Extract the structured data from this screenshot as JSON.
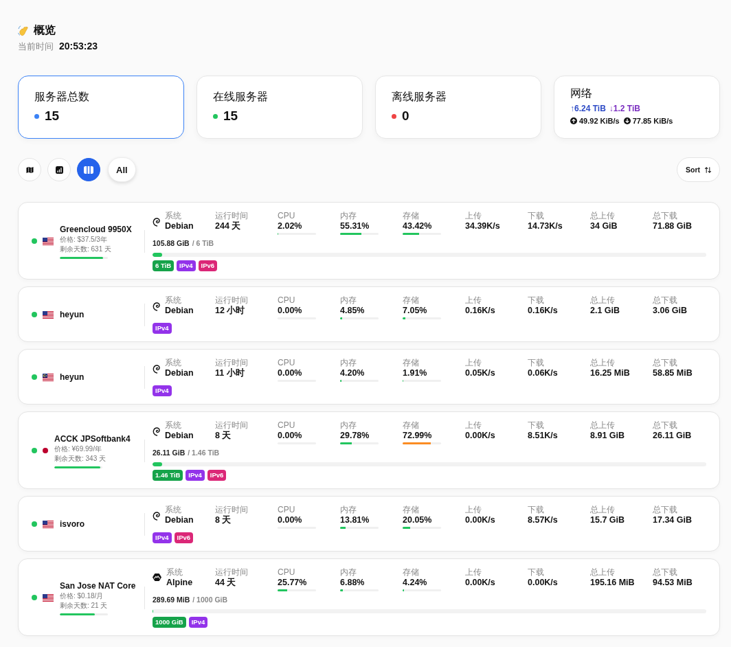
{
  "header": {
    "title": "概览",
    "time_label": "当前时间",
    "time": "20:53:23"
  },
  "stats": [
    {
      "kind": "count",
      "title": "服务器总数",
      "value": "15",
      "color": "#3b82f6",
      "selected": true
    },
    {
      "kind": "count",
      "title": "在线服务器",
      "value": "15",
      "color": "#22c55e",
      "selected": false
    },
    {
      "kind": "count",
      "title": "离线服务器",
      "value": "0",
      "color": "#ef4444",
      "selected": false
    },
    {
      "kind": "network",
      "title": "网络",
      "total_up": "↑6.24 TiB",
      "total_down": "↓1.2 TiB",
      "speed_up": "49.92 KiB/s",
      "speed_down": "77.85 KiB/s",
      "selected": false
    }
  ],
  "views": [
    {
      "kind": "map",
      "selected": false
    },
    {
      "kind": "chart",
      "selected": false
    },
    {
      "kind": "grid",
      "selected": true
    }
  ],
  "groups": [
    {
      "label": "All",
      "selected": true
    }
  ],
  "sort": {
    "label": "Sort"
  },
  "servers": [
    {
      "name": "Greencloud 9950X",
      "online": true,
      "flag": {
        "kind": "us"
      },
      "expiry": {
        "price": "价格: $37.5/3年",
        "remaining": "剩余天数: 631 天",
        "level": 0.9
      },
      "os": {
        "label": "系统",
        "name": "Debian",
        "kind": "debian"
      },
      "metrics": [
        {
          "kind": "text",
          "label": "运行时间",
          "value": "244 天"
        },
        {
          "kind": "meter",
          "label": "CPU",
          "value": "2.02%",
          "level": 0.0202
        },
        {
          "kind": "meter",
          "label": "内存",
          "value": "55.31%",
          "level": 0.5531
        },
        {
          "kind": "meter",
          "label": "存储",
          "value": "43.42%",
          "level": 0.4342
        },
        {
          "kind": "text",
          "label": "上传",
          "value": "34.39K/s"
        },
        {
          "kind": "text",
          "label": "下载",
          "value": "14.73K/s"
        },
        {
          "kind": "text",
          "label": "总上传",
          "value": "34 GiB"
        },
        {
          "kind": "text",
          "label": "总下载",
          "value": "71.88 GiB"
        }
      ],
      "traffic": {
        "used": "105.88 GiB",
        "total": "/ 6 TiB",
        "level": 0.017
      },
      "tags": [
        {
          "kind": "quota",
          "label": "6 TiB"
        },
        {
          "kind": "ipv4",
          "label": "IPv4"
        },
        {
          "kind": "ipv6",
          "label": "IPv6"
        }
      ]
    },
    {
      "name": "heyun",
      "online": true,
      "flag": {
        "kind": "us"
      },
      "os": {
        "label": "系统",
        "name": "Debian",
        "kind": "debian"
      },
      "metrics": [
        {
          "kind": "text",
          "label": "运行时间",
          "value": "12 小时"
        },
        {
          "kind": "meter",
          "label": "CPU",
          "value": "0.00%"
        },
        {
          "kind": "meter",
          "label": "内存",
          "value": "4.85%",
          "level": 0.0485
        },
        {
          "kind": "meter",
          "label": "存储",
          "value": "7.05%",
          "level": 0.0705
        },
        {
          "kind": "text",
          "label": "上传",
          "value": "0.16K/s"
        },
        {
          "kind": "text",
          "label": "下载",
          "value": "0.16K/s"
        },
        {
          "kind": "text",
          "label": "总上传",
          "value": "2.1 GiB"
        },
        {
          "kind": "text",
          "label": "总下载",
          "value": "3.06 GiB"
        }
      ],
      "tags": [
        {
          "kind": "ipv4",
          "label": "IPv4"
        }
      ]
    },
    {
      "name": "heyun",
      "online": true,
      "flag": {
        "kind": "my"
      },
      "os": {
        "label": "系统",
        "name": "Debian",
        "kind": "debian"
      },
      "metrics": [
        {
          "kind": "text",
          "label": "运行时间",
          "value": "11 小时"
        },
        {
          "kind": "meter",
          "label": "CPU",
          "value": "0.00%"
        },
        {
          "kind": "meter",
          "label": "内存",
          "value": "4.20%",
          "level": 0.042
        },
        {
          "kind": "meter",
          "label": "存储",
          "value": "1.91%",
          "level": 0.0191
        },
        {
          "kind": "text",
          "label": "上传",
          "value": "0.05K/s"
        },
        {
          "kind": "text",
          "label": "下载",
          "value": "0.06K/s"
        },
        {
          "kind": "text",
          "label": "总上传",
          "value": "16.25 MiB"
        },
        {
          "kind": "text",
          "label": "总下载",
          "value": "58.85 MiB"
        }
      ],
      "tags": [
        {
          "kind": "ipv4",
          "label": "IPv4"
        }
      ]
    },
    {
      "name": "ACCK JPSoftbank4",
      "online": true,
      "flag": {
        "kind": "jp"
      },
      "expiry": {
        "price": "价格: ¥69.99/年",
        "remaining": "剩余天数: 343 天",
        "level": 0.96
      },
      "os": {
        "label": "系统",
        "name": "Debian",
        "kind": "debian"
      },
      "metrics": [
        {
          "kind": "text",
          "label": "运行时间",
          "value": "8 天"
        },
        {
          "kind": "meter",
          "label": "CPU",
          "value": "0.00%"
        },
        {
          "kind": "meter",
          "label": "内存",
          "value": "29.78%",
          "level": 0.2978
        },
        {
          "kind": "meter",
          "label": "存储",
          "value": "72.99%",
          "level": 0.7299
        },
        {
          "kind": "text",
          "label": "上传",
          "value": "0.00K/s"
        },
        {
          "kind": "text",
          "label": "下载",
          "value": "8.51K/s"
        },
        {
          "kind": "text",
          "label": "总上传",
          "value": "8.91 GiB"
        },
        {
          "kind": "text",
          "label": "总下载",
          "value": "26.11 GiB"
        }
      ],
      "traffic": {
        "used": "26.11 GiB",
        "total": "/ 1.46 TiB",
        "level": 0.017
      },
      "tags": [
        {
          "kind": "quota",
          "label": "1.46 TiB"
        },
        {
          "kind": "ipv4",
          "label": "IPv4"
        },
        {
          "kind": "ipv6",
          "label": "IPv6"
        }
      ]
    },
    {
      "name": "isvoro",
      "online": true,
      "flag": {
        "kind": "us"
      },
      "os": {
        "label": "系统",
        "name": "Debian",
        "kind": "debian"
      },
      "metrics": [
        {
          "kind": "text",
          "label": "运行时间",
          "value": "8 天"
        },
        {
          "kind": "meter",
          "label": "CPU",
          "value": "0.00%"
        },
        {
          "kind": "meter",
          "label": "内存",
          "value": "13.81%",
          "level": 0.1381
        },
        {
          "kind": "meter",
          "label": "存储",
          "value": "20.05%",
          "level": 0.2005
        },
        {
          "kind": "text",
          "label": "上传",
          "value": "0.00K/s"
        },
        {
          "kind": "text",
          "label": "下载",
          "value": "8.57K/s"
        },
        {
          "kind": "text",
          "label": "总上传",
          "value": "15.7 GiB"
        },
        {
          "kind": "text",
          "label": "总下载",
          "value": "17.34 GiB"
        }
      ],
      "tags": [
        {
          "kind": "ipv4",
          "label": "IPv4"
        },
        {
          "kind": "ipv6",
          "label": "IPv6"
        }
      ]
    },
    {
      "name": "San Jose NAT Core",
      "online": true,
      "flag": {
        "kind": "us"
      },
      "expiry": {
        "price": "价格: $0.18/月",
        "remaining": "剩余天数: 21 天",
        "level": 0.73
      },
      "os": {
        "label": "系统",
        "name": "Alpine",
        "kind": "alpine"
      },
      "metrics": [
        {
          "kind": "text",
          "label": "运行时间",
          "value": "44 天"
        },
        {
          "kind": "meter",
          "label": "CPU",
          "value": "25.77%",
          "level": 0.2577
        },
        {
          "kind": "meter",
          "label": "内存",
          "value": "6.88%",
          "level": 0.0688
        },
        {
          "kind": "meter",
          "label": "存储",
          "value": "4.24%",
          "level": 0.0424
        },
        {
          "kind": "text",
          "label": "上传",
          "value": "0.00K/s"
        },
        {
          "kind": "text",
          "label": "下载",
          "value": "0.00K/s"
        },
        {
          "kind": "text",
          "label": "总上传",
          "value": "195.16 MiB"
        },
        {
          "kind": "text",
          "label": "总下载",
          "value": "94.53 MiB"
        }
      ],
      "traffic": {
        "used": "289.69 MiB",
        "total": "/ 1000 GiB",
        "level": 0.0003
      },
      "tags": [
        {
          "kind": "quota",
          "label": "1000 GiB"
        },
        {
          "kind": "ipv4",
          "label": "IPv4"
        }
      ]
    }
  ]
}
